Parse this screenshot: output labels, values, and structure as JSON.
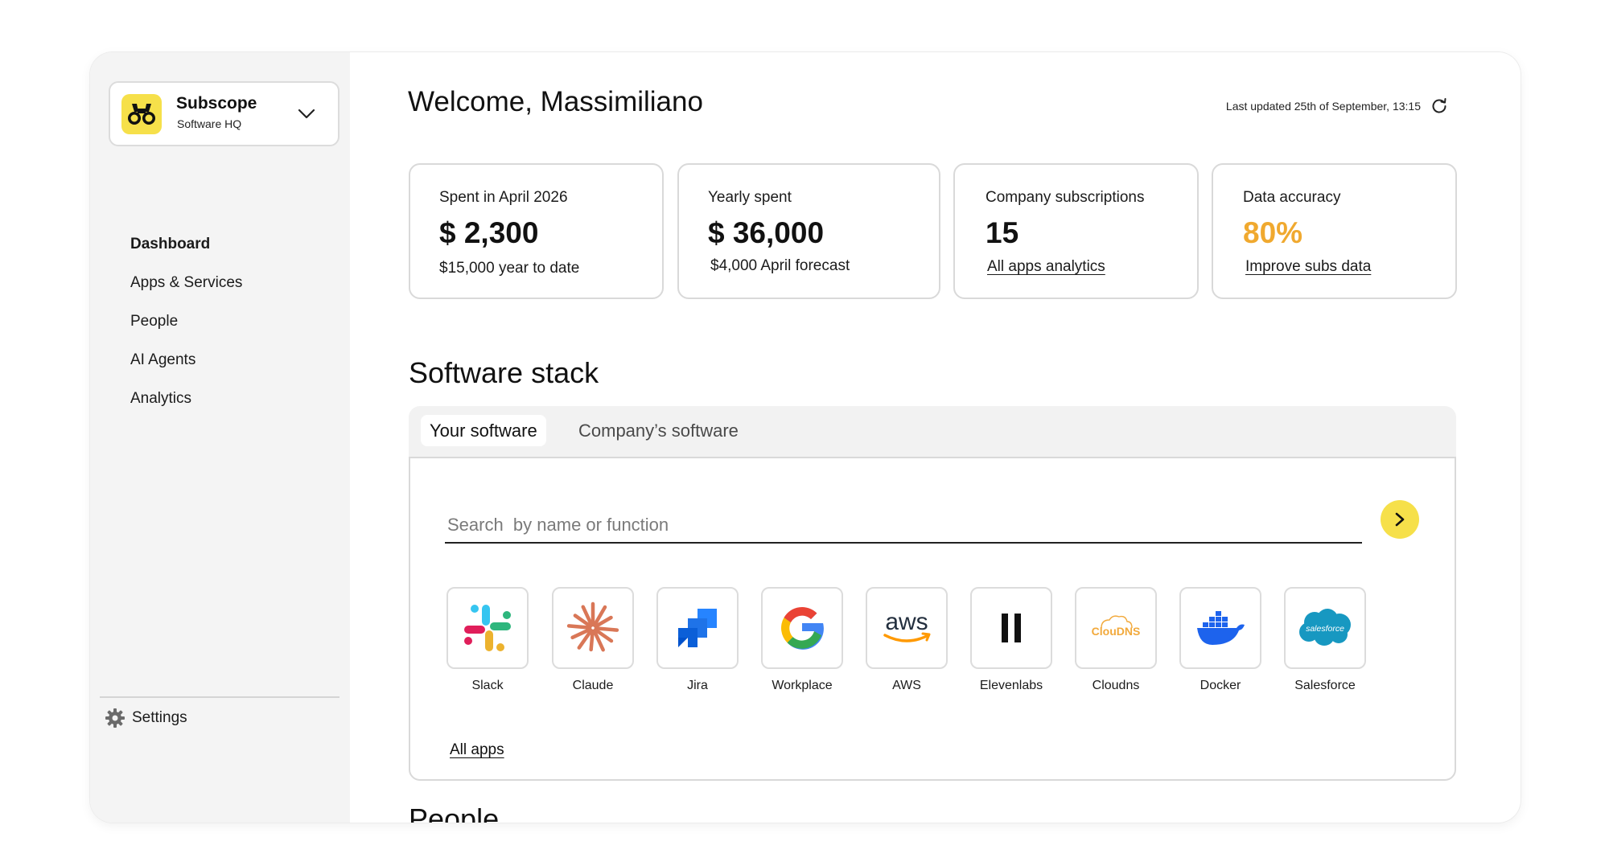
{
  "org": {
    "name": "Subscope",
    "subtitle": "Software HQ",
    "brand_color": "#f6e04a"
  },
  "nav": {
    "items": [
      {
        "label": "Dashboard",
        "active": true
      },
      {
        "label": "Apps & Services",
        "active": false
      },
      {
        "label": "People",
        "active": false
      },
      {
        "label": "AI Agents",
        "active": false
      },
      {
        "label": "Analytics",
        "active": false
      }
    ],
    "settings_label": "Settings"
  },
  "header": {
    "welcome": "Welcome, Massimiliano",
    "last_updated": "Last updated 25th of September, 13:15"
  },
  "stats": [
    {
      "label": "Spent in April 2026",
      "value": "$ 2,300",
      "sub": "$15,000 year to date"
    },
    {
      "label": "Yearly spent",
      "value": "$ 36,000",
      "sub": "$4,000  April forecast"
    },
    {
      "label": "Company subscriptions",
      "value": "15",
      "link": "All apps analytics"
    },
    {
      "label": "Data accuracy",
      "value": "80%",
      "link": "Improve subs data",
      "value_color": "#f0a92f"
    }
  ],
  "software_stack": {
    "title": "Software stack",
    "tabs": [
      {
        "label": "Your software",
        "active": true
      },
      {
        "label": "Company’s software",
        "active": false
      }
    ],
    "search_placeholder": "Search  by name or function",
    "apps": [
      {
        "name": "Slack",
        "icon": "slack-logo"
      },
      {
        "name": "Claude",
        "icon": "claude-logo"
      },
      {
        "name": "Jira",
        "icon": "jira-logo"
      },
      {
        "name": "Workplace",
        "icon": "google-logo"
      },
      {
        "name": "AWS",
        "icon": "aws-logo"
      },
      {
        "name": "Elevenlabs",
        "icon": "elevenlabs-logo"
      },
      {
        "name": "Cloudns",
        "icon": "cloudns-logo"
      },
      {
        "name": "Docker",
        "icon": "docker-logo"
      },
      {
        "name": "Salesforce",
        "icon": "salesforce-logo"
      }
    ],
    "all_apps_label": "All apps"
  },
  "people": {
    "title": "People"
  },
  "colors": {
    "accent_yellow": "#f6e04a",
    "accuracy_orange": "#f0a92f",
    "sidebar_bg": "#f4f4f4"
  },
  "logo_text": {
    "aws": "aws",
    "cloudns": "ClouDNS",
    "salesforce": "salesforce"
  }
}
